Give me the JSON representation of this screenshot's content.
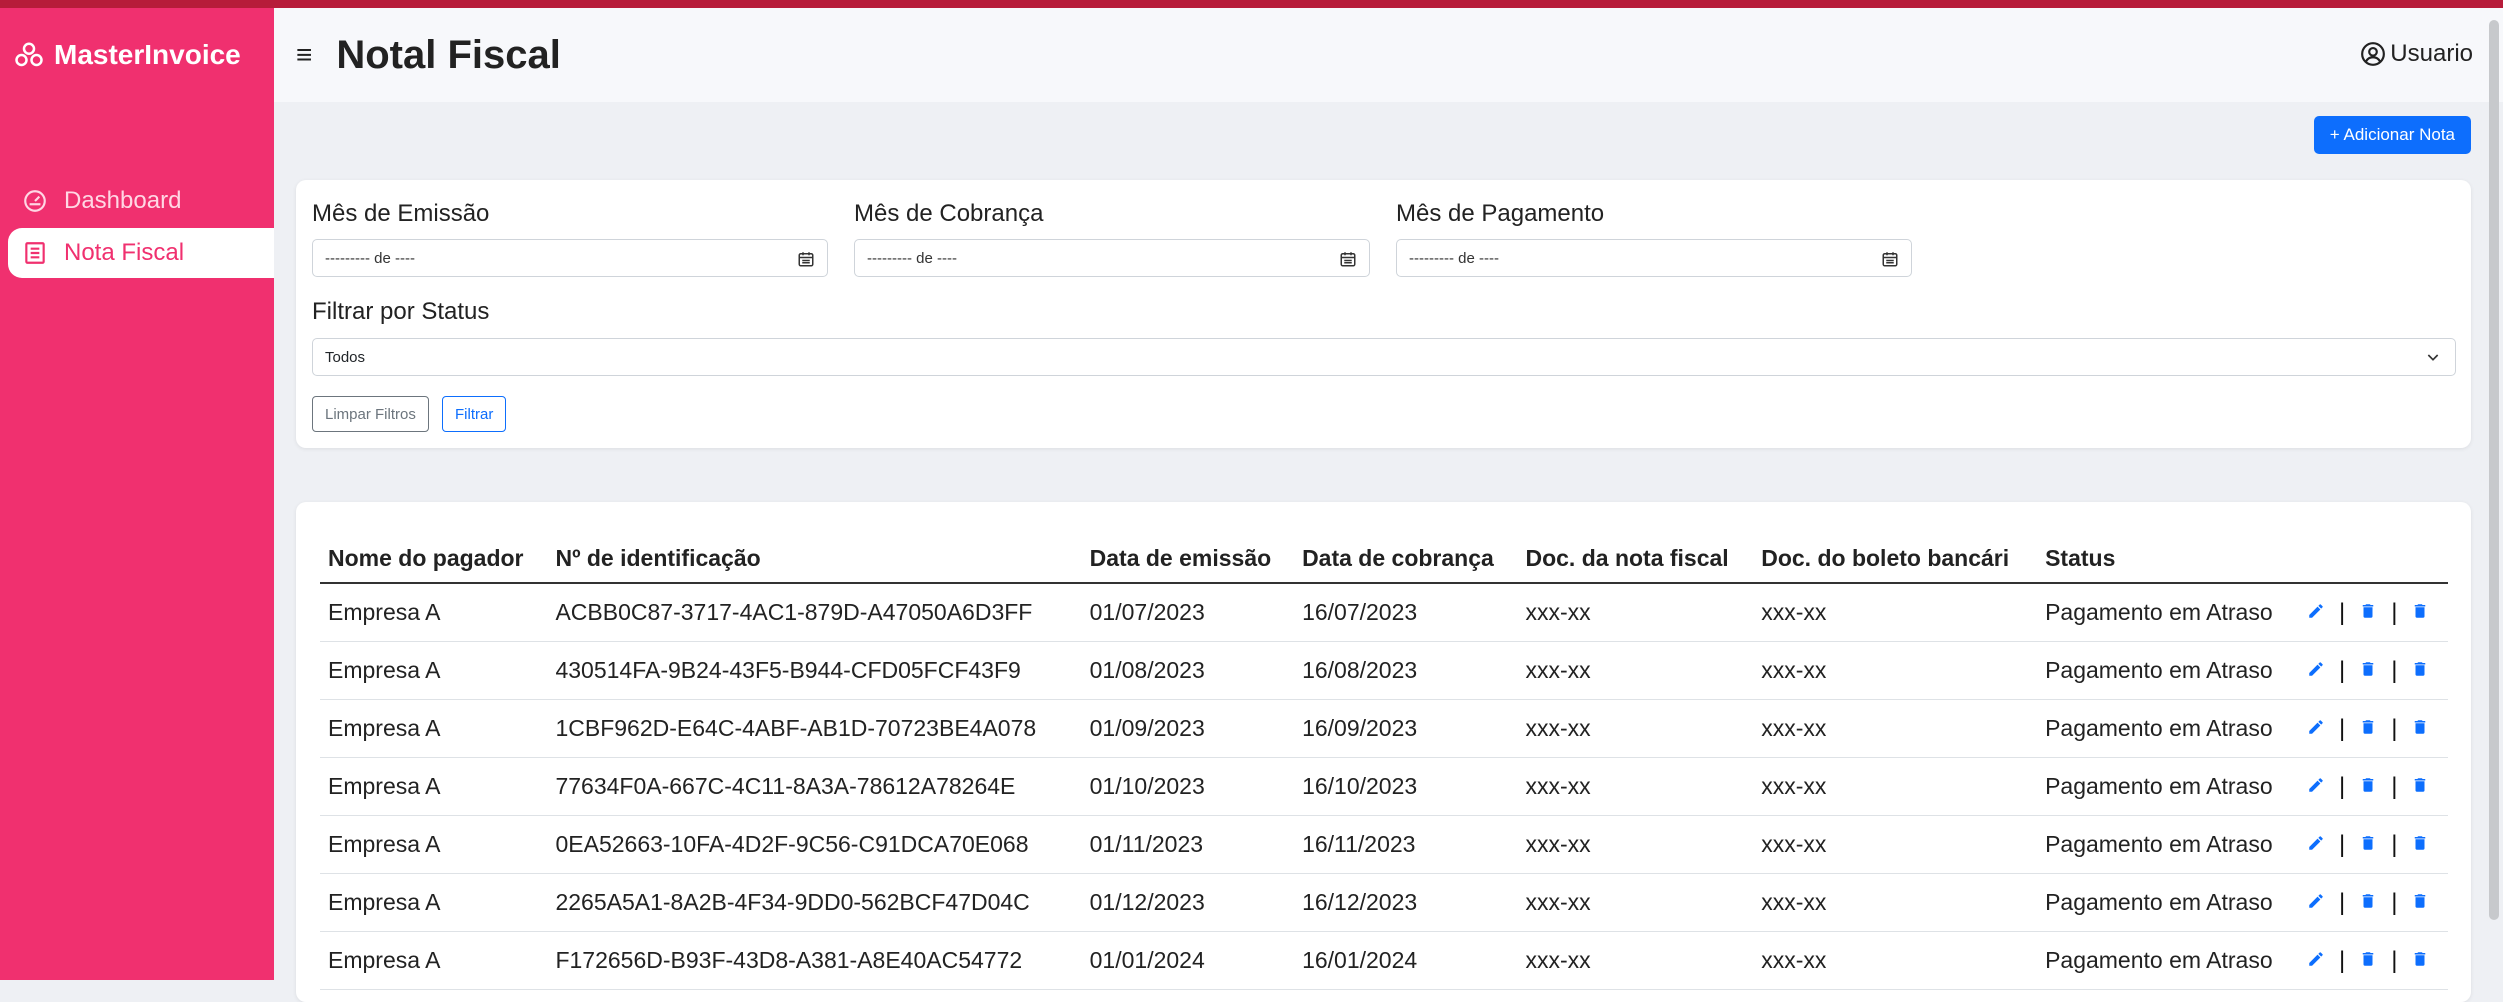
{
  "brand": {
    "name": "MasterInvoice"
  },
  "sidebar": {
    "items": [
      {
        "label": "Dashboard",
        "active": false
      },
      {
        "label": "Nota Fiscal",
        "active": true
      }
    ]
  },
  "header": {
    "title": "Notal Fiscal",
    "user_label": "Usuario"
  },
  "toolbar": {
    "add_label": "+ Adicionar Nota"
  },
  "filters": {
    "emissao_label": "Mês de Emissão",
    "emissao_value": "--------- de ----",
    "cobranca_label": "Mês de Cobrança",
    "cobranca_value": "--------- de ----",
    "pagamento_label": "Mês de Pagamento",
    "pagamento_value": "--------- de ----",
    "status_label": "Filtrar por Status",
    "status_value": "Todos",
    "clear_label": "Limpar Filtros",
    "filter_label": "Filtrar"
  },
  "table": {
    "headers": [
      "Nome do pagador",
      "Nº de identificação",
      "Data de emissão",
      "Data de cobrança",
      "Doc. da nota fiscal",
      "Doc. do boleto bancári",
      "Status"
    ],
    "rows": [
      [
        "Empresa A",
        "ACBB0C87-3717-4AC1-879D-A47050A6D3FF",
        "01/07/2023",
        "16/07/2023",
        "xxx-xx",
        "xxx-xx",
        "Pagamento em Atraso"
      ],
      [
        "Empresa A",
        "430514FA-9B24-43F5-B944-CFD05FCF43F9",
        "01/08/2023",
        "16/08/2023",
        "xxx-xx",
        "xxx-xx",
        "Pagamento em Atraso"
      ],
      [
        "Empresa A",
        "1CBF962D-E64C-4ABF-AB1D-70723BE4A078",
        "01/09/2023",
        "16/09/2023",
        "xxx-xx",
        "xxx-xx",
        "Pagamento em Atraso"
      ],
      [
        "Empresa A",
        "77634F0A-667C-4C11-8A3A-78612A78264E",
        "01/10/2023",
        "16/10/2023",
        "xxx-xx",
        "xxx-xx",
        "Pagamento em Atraso"
      ],
      [
        "Empresa A",
        "0EA52663-10FA-4D2F-9C56-C91DCA70E068",
        "01/11/2023",
        "16/11/2023",
        "xxx-xx",
        "xxx-xx",
        "Pagamento em Atraso"
      ],
      [
        "Empresa A",
        "2265A5A1-8A2B-4F34-9DD0-562BCF47D04C",
        "01/12/2023",
        "16/12/2023",
        "xxx-xx",
        "xxx-xx",
        "Pagamento em Atraso"
      ],
      [
        "Empresa A",
        "F172656D-B93F-43D8-A381-A8E40AC54772",
        "01/01/2024",
        "16/01/2024",
        "xxx-xx",
        "xxx-xx",
        "Pagamento em Atraso"
      ]
    ]
  },
  "colors": {
    "sidebar": "#f0306f",
    "accent": "#0d6efd",
    "top_strip": "#b71c3a"
  },
  "icons": {
    "edit": "pencil-icon",
    "delete": "trash-icon",
    "user": "user-circle-icon",
    "brand": "logo-icon",
    "menu": "menu-icon",
    "calendar": "calendar-icon"
  }
}
